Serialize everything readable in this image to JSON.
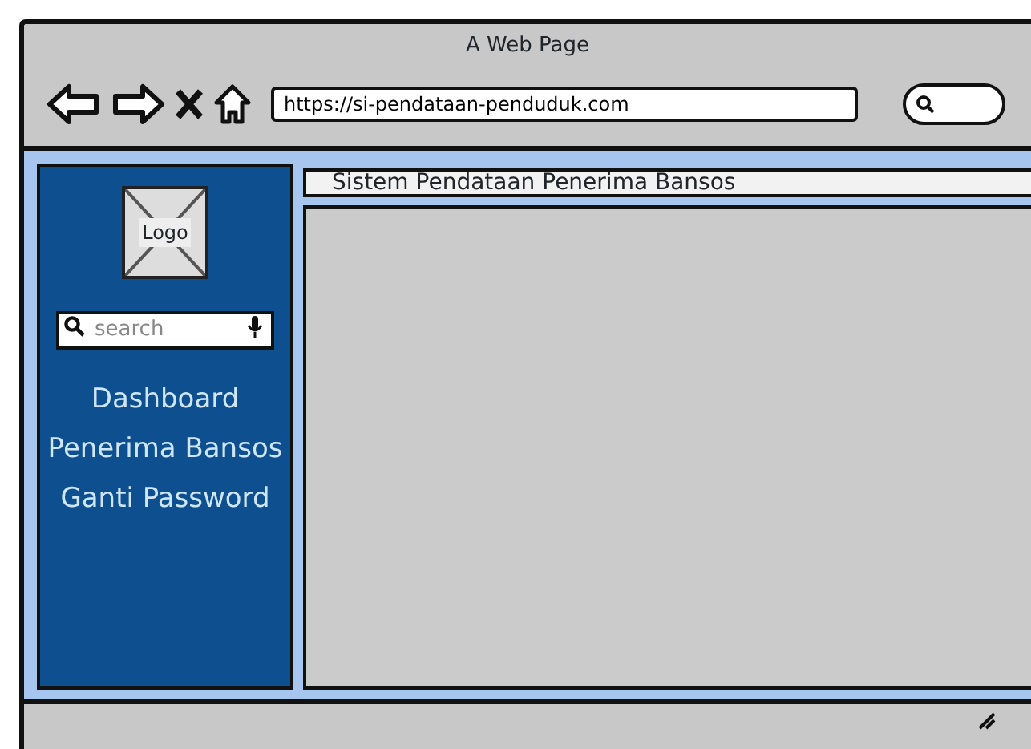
{
  "window": {
    "title": "A Web Page"
  },
  "browser": {
    "url": "https://si-pendataan-penduduk.com"
  },
  "sidebar": {
    "logo": "Logo",
    "search": {
      "placeholder": "search"
    },
    "items": [
      {
        "label": "Dashboard"
      },
      {
        "label": "Penerima Bansos"
      },
      {
        "label": "Ganti Password"
      }
    ]
  },
  "header": {
    "title": "Sistem Pendataan Penerima Bansos"
  }
}
